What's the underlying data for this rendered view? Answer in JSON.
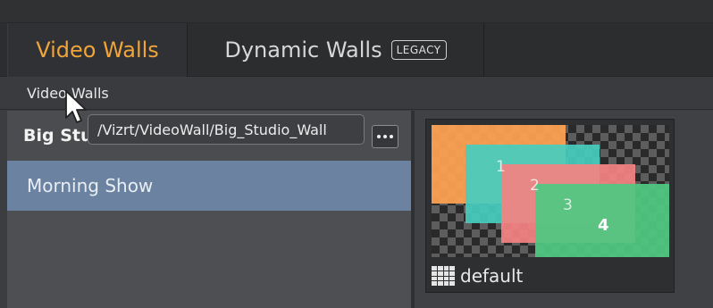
{
  "tabs": [
    {
      "label": "Video Walls",
      "active": true
    },
    {
      "label": "Dynamic Walls",
      "badge": "LEGACY",
      "active": false
    }
  ],
  "section_header": "Video Walls",
  "panel": {
    "title": "Big Studio Wall",
    "more_button_icon": "more-horizontal-icon",
    "items": [
      {
        "label": "Morning Show",
        "selected": true
      }
    ],
    "tooltip": "/Vizrt/VideoWall/Big_Studio_Wall"
  },
  "layout_card": {
    "name": "default",
    "icon": "grid-icon",
    "regions": [
      {
        "label": "1",
        "color": "#faa050"
      },
      {
        "label": "2",
        "color": "#46cdbe"
      },
      {
        "label": "3",
        "color": "#f58282"
      },
      {
        "label": "4",
        "color": "#50c882"
      }
    ]
  },
  "colors": {
    "active_tab": "#f0a43a",
    "selected_item": "#6b82a0"
  }
}
